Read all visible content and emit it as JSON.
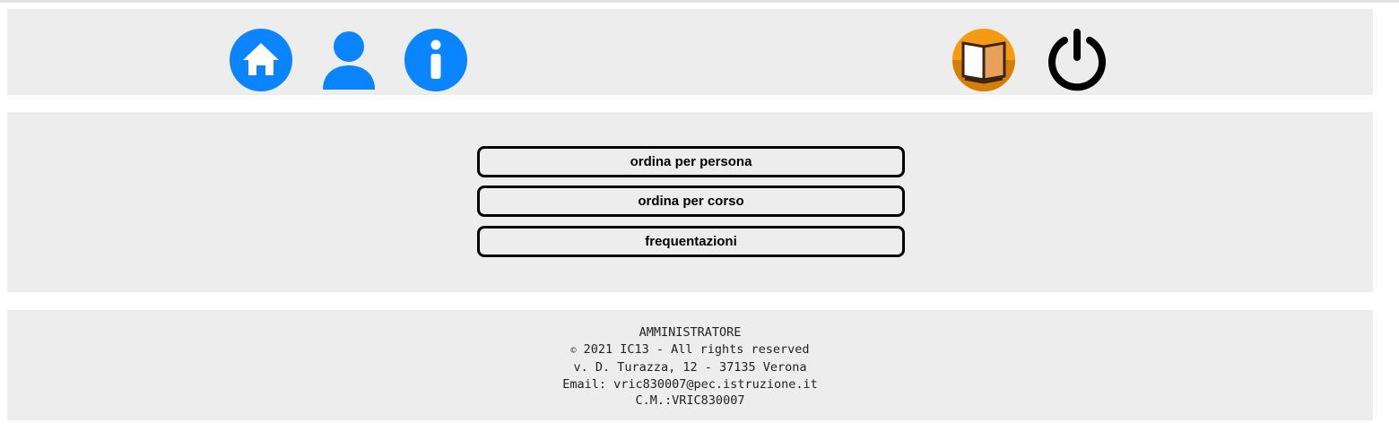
{
  "navbar": {
    "icons": {
      "home": "home-icon",
      "user": "user-icon",
      "info": "info-icon",
      "registro": "open-book-icon",
      "logout": "power-icon"
    },
    "colors": {
      "blue": "#0a84ff",
      "orange": "#f39c12",
      "black": "#000000"
    }
  },
  "main": {
    "buttons": [
      {
        "label": "ordina per persona"
      },
      {
        "label": "ordina per corso"
      },
      {
        "label": "frequentazioni"
      }
    ]
  },
  "footer": {
    "role": "AMMINISTRATORE",
    "copyright_symbol": "©",
    "copyright_text": " 2021 IC13 - All rights reserved",
    "address": "v. D. Turazza, 12 - 37135 Verona",
    "email": "Email: vric830007@pec.istruzione.it",
    "code": "C.M.:VRIC830007"
  },
  "colors": {
    "panel_bg": "#ededed",
    "page_bg": "#ffffff"
  }
}
